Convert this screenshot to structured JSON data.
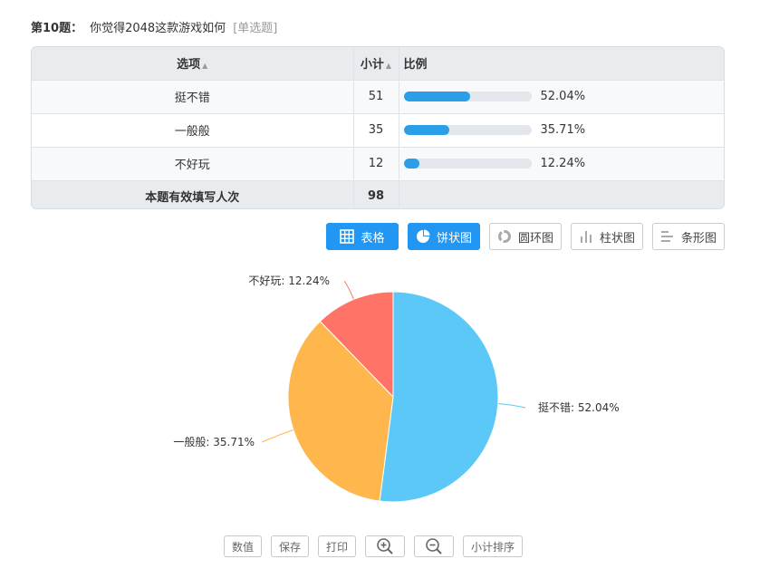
{
  "question": {
    "number_label": "第10题：",
    "text": "你觉得2048这款游戏如何",
    "type": "[单选题]"
  },
  "table": {
    "headers": {
      "option": "选项",
      "count": "小计",
      "ratio": "比例"
    },
    "rows": [
      {
        "option": "挺不错",
        "count": "51",
        "percent_label": "52.04%",
        "percent": 52.04
      },
      {
        "option": "一般般",
        "count": "35",
        "percent_label": "35.71%",
        "percent": 35.71
      },
      {
        "option": "不好玩",
        "count": "12",
        "percent_label": "12.24%",
        "percent": 12.24
      }
    ],
    "footer": {
      "label": "本题有效填写人次",
      "total": "98"
    }
  },
  "chart_buttons": [
    {
      "label": "表格",
      "icon": "table-icon",
      "active": true
    },
    {
      "label": "饼状图",
      "icon": "pie-chart-icon",
      "active": true
    },
    {
      "label": "圆环图",
      "icon": "donut-chart-icon",
      "active": false
    },
    {
      "label": "柱状图",
      "icon": "bar-chart-icon",
      "active": false
    },
    {
      "label": "条形图",
      "icon": "horizontal-bar-icon",
      "active": false
    }
  ],
  "chart_data": {
    "type": "pie",
    "categories": [
      "挺不错",
      "一般般",
      "不好玩"
    ],
    "values": [
      52.04,
      35.71,
      12.24
    ],
    "labels": [
      "挺不错: 52.04%",
      "一般般: 35.71%",
      "不好玩: 12.24%"
    ],
    "colors": [
      "#5bc8f7",
      "#ffb74d",
      "#ff7467"
    ]
  },
  "tools": {
    "values": "数值",
    "save": "保存",
    "print": "打印",
    "zoom_in": "zoom-in-icon",
    "zoom_out": "zoom-out-icon",
    "sort": "小计排序"
  },
  "colors": {
    "accent": "#2196f3",
    "bar_fill": "#2b9ee8"
  }
}
